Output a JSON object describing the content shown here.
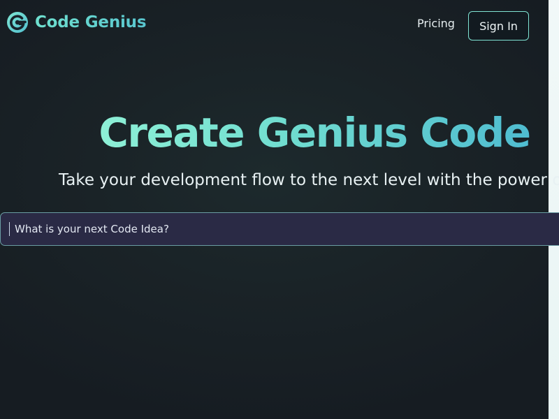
{
  "header": {
    "brand_name": "Code Genius",
    "logo_icon": "genius-logo-icon",
    "nav": {
      "pricing_label": "Pricing",
      "signin_label": "Sign In"
    }
  },
  "hero": {
    "title": "Create Genius Code",
    "subtitle": "Take your development flow to the next level with the power of"
  },
  "prompt": {
    "placeholder": "What is your next Code Idea?",
    "value": ""
  },
  "colors": {
    "brand_gradient_start": "#8ef0d6",
    "brand_gradient_end": "#4fbcd0",
    "background": "#1a2327",
    "input_background": "#2a2a45",
    "button_border": "#7fe3d3"
  }
}
